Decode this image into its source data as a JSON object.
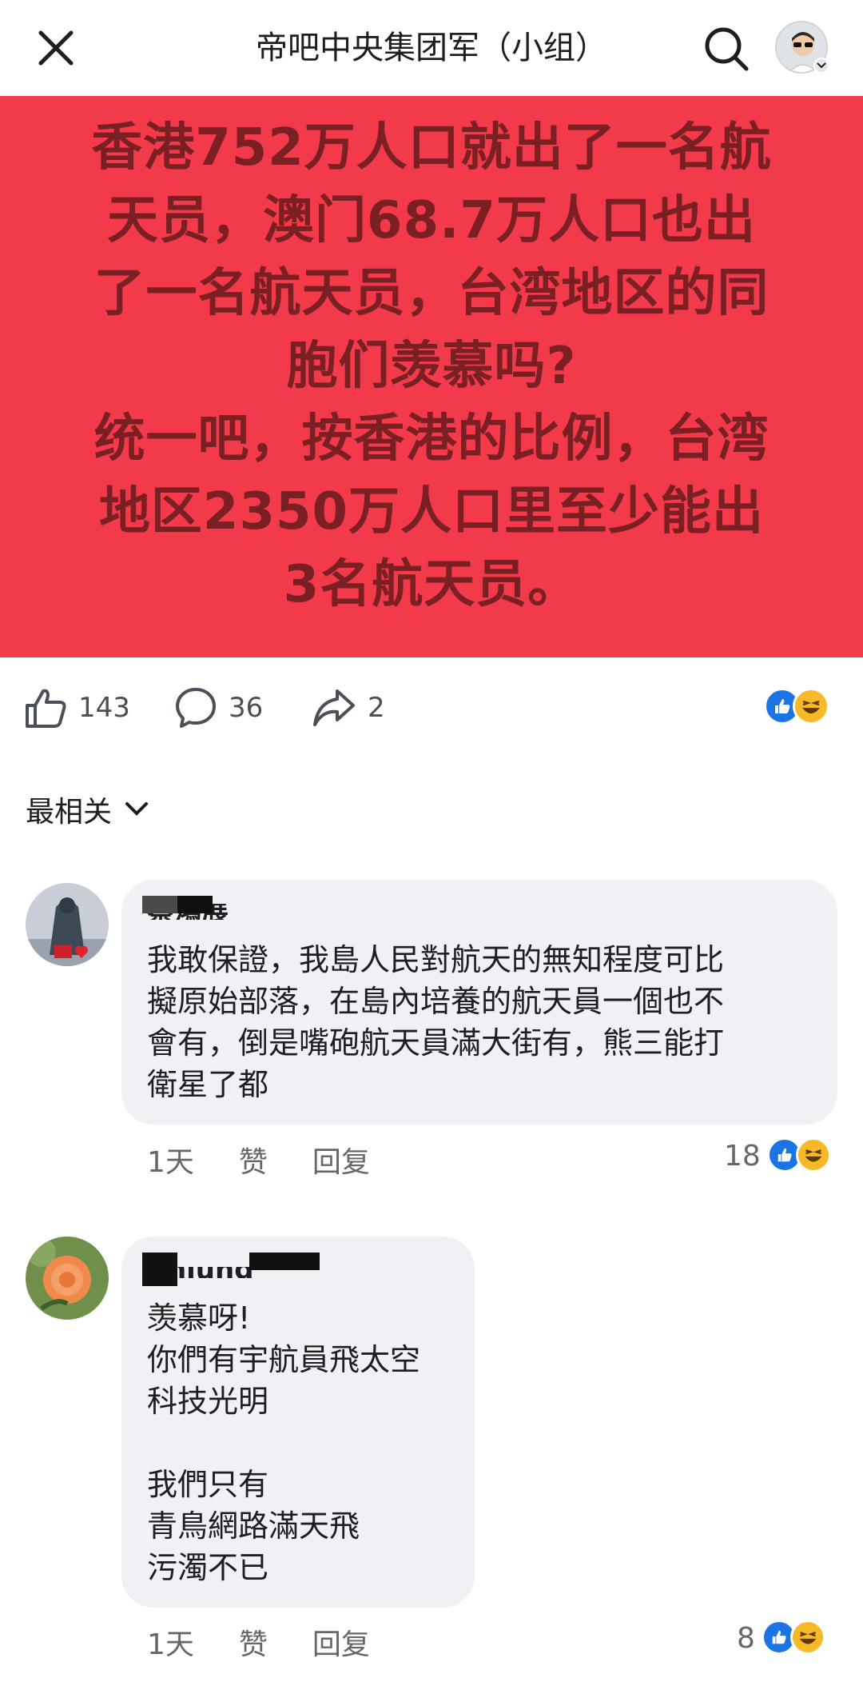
{
  "header": {
    "title": "帝吧中央集团军（小组）"
  },
  "post": {
    "text": "香港752万人口就出了一名航\n天员，澳门68.7万人口也出\n了一名航天员，台湾地区的同\n胞们羡慕吗?\n统一吧，按香港的比例，台湾\n地区2350万人口里至少能出\n3名航天员。",
    "background_color": "#f33a4a"
  },
  "actions": {
    "like_count": "143",
    "comment_count": "36",
    "share_count": "2"
  },
  "sort": {
    "label": "最相关"
  },
  "comments": [
    {
      "author": "蔡鴻展",
      "body": "我敢保證，我島人民對航天的無知程度可比\n擬原始部落，在島內培養的航天員一個也不\n會有，倒是嘴砲航天員滿大街有，熊三能打\n衛星了都",
      "time": "1天",
      "like_label": "赞",
      "reply_label": "回复",
      "reaction_count": "18"
    },
    {
      "author": "Chiung",
      "body": "羡慕呀!\n你們有宇航員飛太空\n科技光明\n\n我們只有\n青鳥網路滿天飛\n污濁不已",
      "time": "1天",
      "like_label": "赞",
      "reply_label": "回复",
      "reaction_count": "8"
    }
  ],
  "colors": {
    "like_blue": "#1b74e4",
    "haha_yellow": "#f7b928",
    "bubble_gray": "#eff1f4",
    "meta_gray": "#65676b"
  },
  "icons": [
    "close-icon",
    "search-icon",
    "thumbs-up-icon",
    "comment-icon",
    "share-icon",
    "chevron-down-icon"
  ]
}
